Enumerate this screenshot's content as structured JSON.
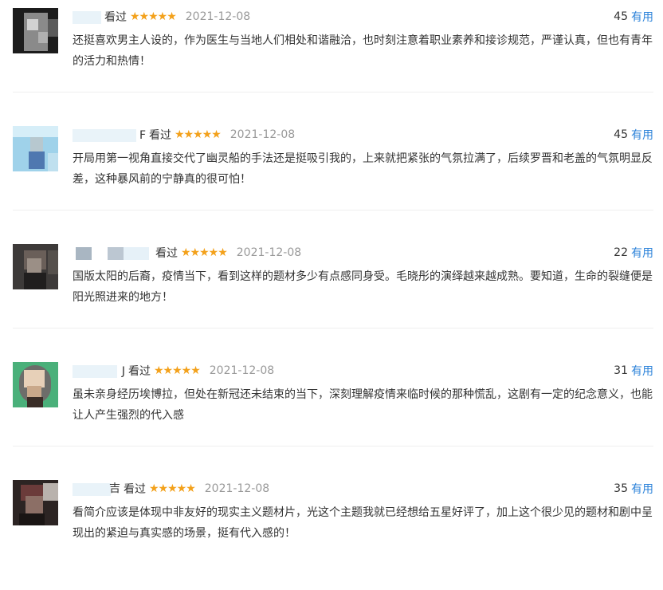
{
  "reviews": [
    {
      "user_suffix": "",
      "seen": "看过",
      "stars": "★★★★★",
      "date": "2021-12-08",
      "votes": "45",
      "useful": "有用",
      "content": "还挺喜欢男主人设的，作为医生与当地人们相处和谐融洽，也时刻注意着职业素养和接诊规范，严谨认真，但也有青年的活力和热情！"
    },
    {
      "user_suffix": "F",
      "seen": "看过",
      "stars": "★★★★★",
      "date": "2021-12-08",
      "votes": "45",
      "useful": "有用",
      "content": "开局用第一视角直接交代了幽灵船的手法还是挺吸引我的，上来就把紧张的气氛拉满了，后续罗晋和老盖的气氛明显反差，这种暴风前的宁静真的很可怕！"
    },
    {
      "user_suffix": "",
      "seen": "看过",
      "stars": "★★★★★",
      "date": "2021-12-08",
      "votes": "22",
      "useful": "有用",
      "content": "国版太阳的后裔，疫情当下，看到这样的题材多少有点感同身受。毛晓彤的演绎越来越成熟。要知道，生命的裂缝便是阳光照进来的地方！"
    },
    {
      "user_suffix": "J",
      "seen": "看过",
      "stars": "★★★★★",
      "date": "2021-12-08",
      "votes": "31",
      "useful": "有用",
      "content": "虽未亲身经历埃博拉，但处在新冠还未结束的当下，深刻理解疫情来临时候的那种慌乱，这剧有一定的纪念意义，也能让人产生强烈的代入感"
    },
    {
      "user_suffix": "吉",
      "seen": "看过",
      "stars": "★★★★★",
      "date": "2021-12-08",
      "votes": "35",
      "useful": "有用",
      "content": "看简介应该是体现中非友好的现实主义题材片，光这个主题我就已经想给五星好评了，加上这个很少见的题材和剧中呈现出的紧迫与真实感的场景，挺有代入感的！"
    }
  ]
}
